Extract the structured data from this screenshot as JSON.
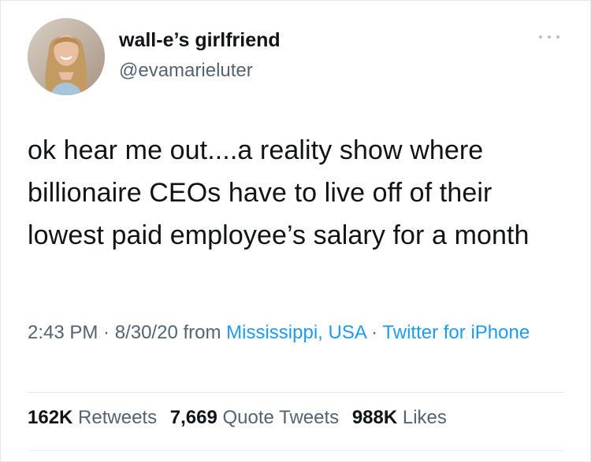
{
  "user": {
    "display_name": "wall-e’s girlfriend",
    "handle": "@evamarieluter"
  },
  "more_icon": "more-horizontal-icon",
  "tweet": {
    "text": "ok hear me out....a reality show where billionaire CEOs have to live off of their lowest paid employee’s salary for a month"
  },
  "meta": {
    "time": "2:43 PM",
    "sep1": " · ",
    "date": "8/30/20",
    "from_label": " from ",
    "location": "Mississippi, USA",
    "sep2": " · ",
    "source": "Twitter for iPhone"
  },
  "stats": {
    "retweets_count": "162K",
    "retweets_label": "Retweets",
    "quotes_count": "7,669",
    "quotes_label": "Quote Tweets",
    "likes_count": "988K",
    "likes_label": "Likes"
  },
  "colors": {
    "text": "#0f1419",
    "secondary": "#536471",
    "link": "#1d9bf0"
  }
}
